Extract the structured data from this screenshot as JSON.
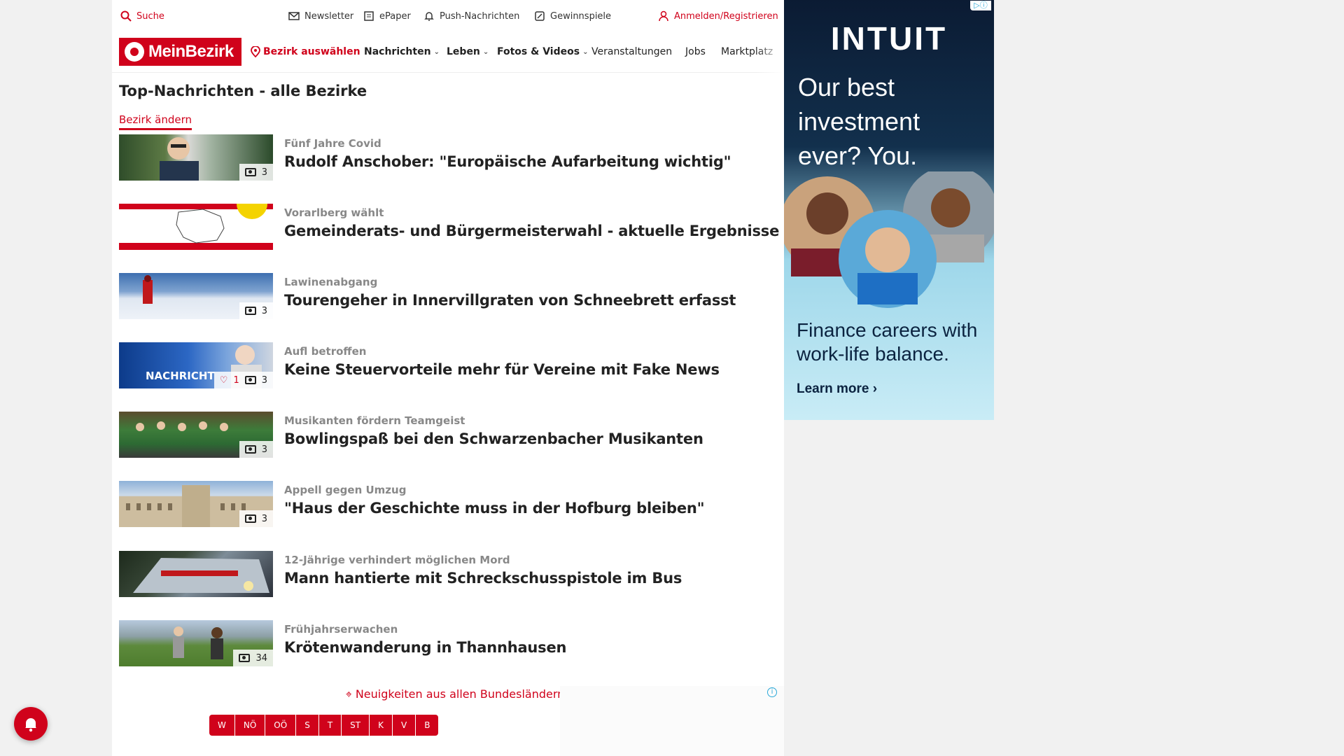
{
  "utility": {
    "search": "Suche",
    "newsletter": "Newsletter",
    "epaper": "ePaper",
    "push": "Push-Nachrichten",
    "contests": "Gewinnspiele",
    "login": "Anmelden/Registrieren"
  },
  "nav": {
    "logo": "MeinBezirk",
    "district": "Bezirk auswählen",
    "news": "Nachrichten",
    "life": "Leben",
    "photos": "Fotos & Videos",
    "events": "Veranstaltungen",
    "jobs": "Jobs",
    "market": "Marktplatz"
  },
  "section": {
    "title": "Top-Nachrichten - alle Bezirke",
    "change_link": "Bezirk ändern"
  },
  "articles": [
    {
      "kicker": "Fünf Jahre Covid",
      "headline": "Rudolf Anschober: \"Europäische Aufarbeitung wichtig\"",
      "photos": "3"
    },
    {
      "kicker": "Vorarlberg wählt",
      "headline": "Gemeinderats- und Bürgermeisterwahl - aktuelle Ergebnisse"
    },
    {
      "kicker": "Lawinenabgang",
      "headline": "Tourengeher in Innervillgraten von Schneebrett erfasst",
      "photos": "3"
    },
    {
      "kicker": "Aufl betroffen",
      "headline": "Keine Steuervorteile mehr für Vereine mit Fake News",
      "photos": "3",
      "likes": "1",
      "thumb_text": "NACHRICHT"
    },
    {
      "kicker": "Musikanten fördern Teamgeist",
      "headline": "Bowlingspaß bei den Schwarzenbacher Musikanten",
      "photos": "3"
    },
    {
      "kicker": "Appell gegen Umzug",
      "headline": "\"Haus der Geschichte muss in der Hofburg bleiben\"",
      "photos": "3"
    },
    {
      "kicker": "12-Jährige verhindert möglichen Mord",
      "headline": "Mann hantierte mit Schreckschusspistole im Bus"
    },
    {
      "kicker": "Frühjahrserwachen",
      "headline": "Krötenwanderung in Thannhausen",
      "photos": "34"
    }
  ],
  "states": {
    "title": "Neuigkeiten aus allen Bundesländern",
    "items": [
      "W",
      "NÖ",
      "OÖ",
      "S",
      "T",
      "ST",
      "K",
      "V",
      "B"
    ]
  },
  "ad": {
    "brand": "INTUIT",
    "headline": "Our best investment ever? You.",
    "sub": "Finance careers with work-life balance.",
    "cta": "Learn more ›"
  },
  "colors": {
    "brand_red": "#d0021b",
    "text": "#222222",
    "kicker": "#888888"
  }
}
